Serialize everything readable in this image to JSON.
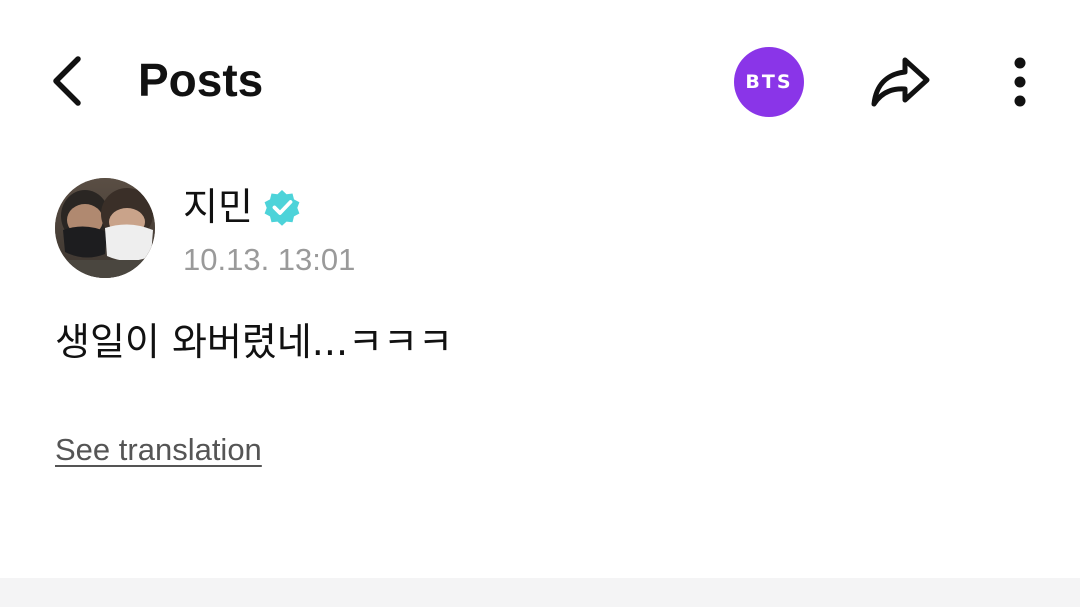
{
  "header": {
    "back_icon": "chevron-left-icon",
    "title": "Posts",
    "community_badge": "BTS",
    "community_badge_color": "#8a35e8",
    "share_icon": "share-arrow-icon",
    "more_icon": "vertical-dots-icon"
  },
  "post": {
    "author": {
      "name": "지민",
      "verified_icon": "verified-badge-icon",
      "verified_color": "#4dd3d9"
    },
    "timestamp": "10.13. 13:01",
    "body": "생일이 와버렸네...ㅋㅋㅋ",
    "translate_label": "See translation"
  }
}
